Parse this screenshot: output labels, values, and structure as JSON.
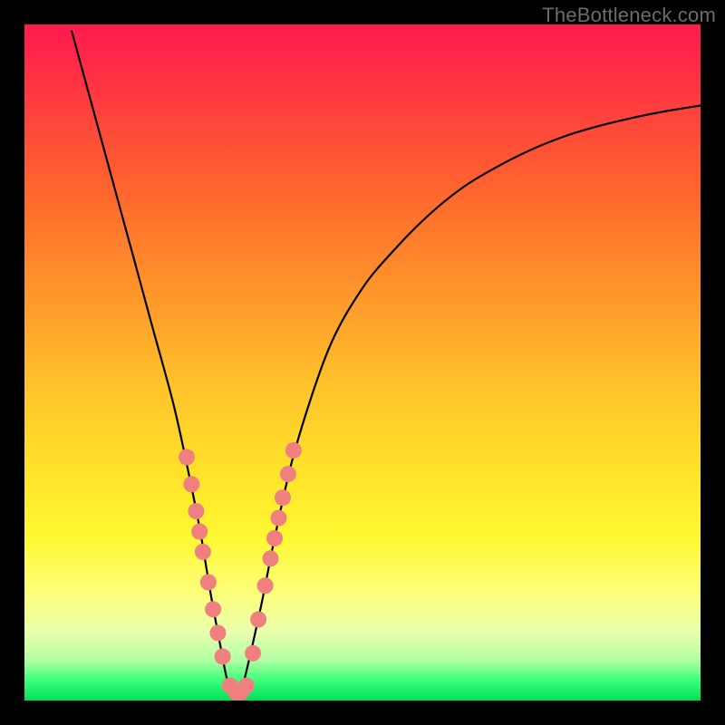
{
  "watermark": "TheBottleneck.com",
  "chart_data": {
    "type": "line",
    "title": "",
    "xlabel": "",
    "ylabel": "",
    "xlim": [
      0,
      100
    ],
    "ylim": [
      0,
      100
    ],
    "grid": false,
    "series": [
      {
        "name": "bottleneck-curve",
        "x": [
          7,
          10,
          13,
          16,
          19,
          22,
          24,
          26,
          27.5,
          29,
          30,
          31,
          31.8,
          32.5,
          35,
          37,
          40,
          45,
          50,
          55,
          60,
          65,
          70,
          75,
          80,
          85,
          90,
          95,
          100
        ],
        "y": [
          99,
          88,
          77,
          66,
          55,
          44,
          35,
          25,
          16,
          8,
          3,
          1,
          1,
          3,
          14,
          24,
          37,
          52,
          61,
          67,
          72,
          76,
          79,
          81.5,
          83.5,
          85,
          86.2,
          87.2,
          88
        ]
      }
    ],
    "markers": {
      "name": "highlighted-points",
      "color": "#f08080",
      "points": [
        {
          "x": 24.0,
          "y": 36
        },
        {
          "x": 24.7,
          "y": 32
        },
        {
          "x": 25.4,
          "y": 28
        },
        {
          "x": 25.9,
          "y": 25
        },
        {
          "x": 26.4,
          "y": 22
        },
        {
          "x": 27.2,
          "y": 17.5
        },
        {
          "x": 27.9,
          "y": 13.5
        },
        {
          "x": 28.6,
          "y": 10
        },
        {
          "x": 29.3,
          "y": 6.5
        },
        {
          "x": 30.4,
          "y": 2.2
        },
        {
          "x": 31.3,
          "y": 1.2
        },
        {
          "x": 32.0,
          "y": 1.2
        },
        {
          "x": 32.8,
          "y": 2.2
        },
        {
          "x": 33.8,
          "y": 7
        },
        {
          "x": 34.6,
          "y": 12
        },
        {
          "x": 35.6,
          "y": 17
        },
        {
          "x": 36.4,
          "y": 21
        },
        {
          "x": 37.0,
          "y": 24
        },
        {
          "x": 37.6,
          "y": 27
        },
        {
          "x": 38.2,
          "y": 30
        },
        {
          "x": 39.0,
          "y": 33.5
        },
        {
          "x": 39.8,
          "y": 37
        }
      ]
    }
  }
}
